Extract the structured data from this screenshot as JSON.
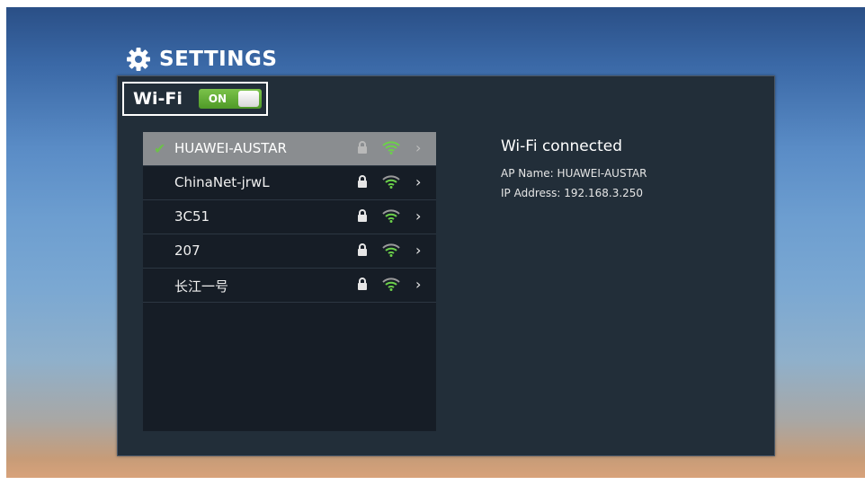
{
  "header": {
    "title": "SETTINGS",
    "icon": "gear-icon"
  },
  "wifi": {
    "label": "Wi-Fi",
    "toggle_label": "ON",
    "toggle_color": "#6bb33a"
  },
  "networks": [
    {
      "name": "HUAWEI-AUSTAR",
      "connected": true,
      "locked": true
    },
    {
      "name": "ChinaNet-jrwL",
      "connected": false,
      "locked": true
    },
    {
      "name": "3C51",
      "connected": false,
      "locked": true
    },
    {
      "name": "207",
      "connected": false,
      "locked": true
    },
    {
      "name": "长江一号",
      "connected": false,
      "locked": true
    }
  ],
  "details": {
    "status": "Wi-Fi connected",
    "ap_label": "AP Name:",
    "ap_name": "HUAWEI-AUSTAR",
    "ip_label": "IP Address:",
    "ip_address": "192.168.3.250"
  }
}
